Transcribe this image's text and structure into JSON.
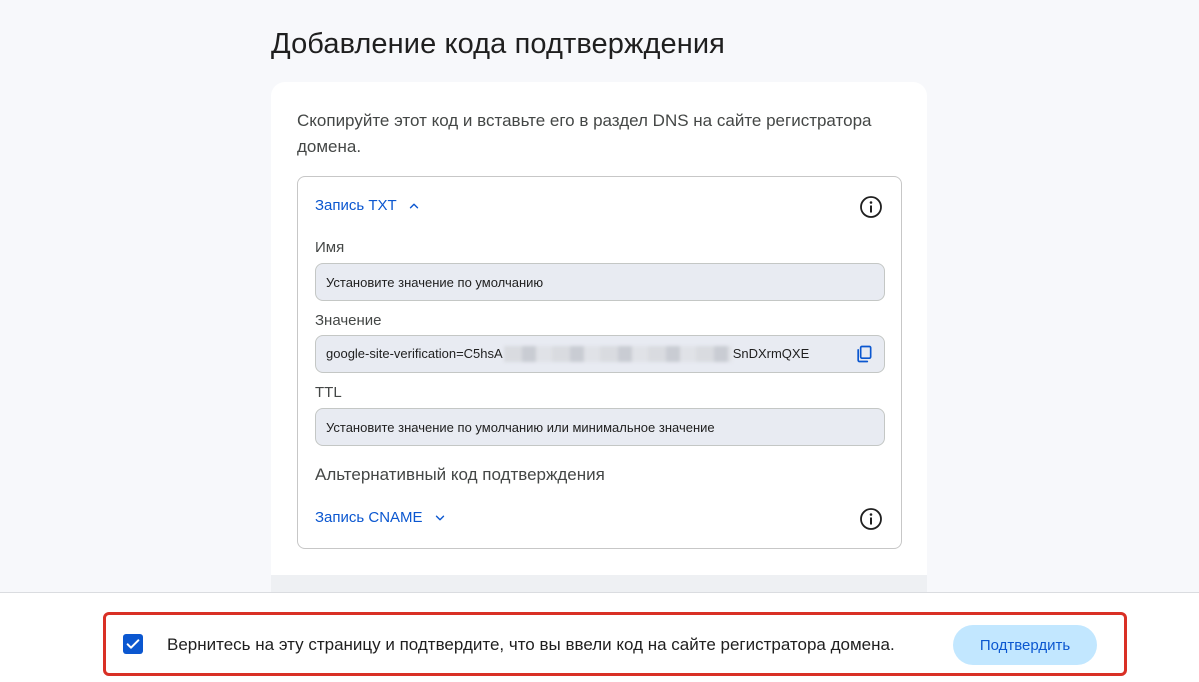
{
  "page": {
    "title": "Добавление кода подтверждения"
  },
  "card": {
    "instructions": "Скопируйте этот код и вставьте его в раздел DNS на сайте регистратора домена."
  },
  "txt_record": {
    "header": "Запись TXT",
    "expanded": true,
    "name_label": "Имя",
    "name_value": "Установите значение по умолчанию",
    "value_label": "Значение",
    "value_prefix": "google-site-verification=C5hsA",
    "value_suffix": "SnDXrmQXE",
    "ttl_label": "TTL",
    "ttl_value": "Установите значение по умолчанию или минимальное значение"
  },
  "alternative": {
    "title": "Альтернативный код подтверждения",
    "cname_header": "Запись CNAME",
    "expanded": false
  },
  "footer": {
    "checkbox_checked": true,
    "confirm_text": "Вернитесь на эту страницу и подтвердите, что вы ввели код на сайте регистратора домена.",
    "button_label": "Подтвердить"
  },
  "icons": {
    "txt_chevron": "chevron-up-icon",
    "cname_chevron": "chevron-down-icon",
    "info": "info-icon",
    "copy": "copy-icon",
    "check": "check-icon"
  },
  "colors": {
    "accent": "#0b57d0",
    "button_bg": "#c2e7ff",
    "highlight": "#d93025",
    "field_bg": "#e8ebf2",
    "page_bg": "#f7f8fb"
  }
}
